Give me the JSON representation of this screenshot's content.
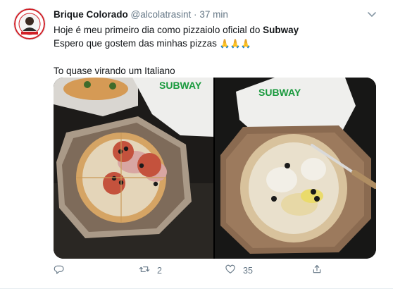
{
  "tweet": {
    "author_name": "Brique Colorado",
    "author_handle": "@alcolatrasint",
    "separator": "·",
    "time": "37 min",
    "text_line1_prefix": "Hoje é meu primeiro dia como pizzaiolo oficial do ",
    "text_line1_bold": "Subway",
    "text_line2": "Espero que gostem das minhas pizzas ",
    "emojis": "🙏🙏🙏",
    "text_line4": "To quase virando um Italiano"
  },
  "media": {
    "left_photo_box_brand": "SUBWAY",
    "right_photo_box_brand": "SUBWAY"
  },
  "actions": {
    "reply_count": "",
    "retweet_count": "2",
    "like_count": "35",
    "share_count": ""
  },
  "colors": {
    "secondary_text": "#657786",
    "icon": "#657786",
    "brand_green": "#1a9a3e",
    "brand_yellow": "#f2c200"
  },
  "icons": {
    "reply": "reply-icon",
    "retweet": "retweet-icon",
    "like": "like-icon",
    "share": "share-icon",
    "caret": "chevron-down-icon"
  }
}
